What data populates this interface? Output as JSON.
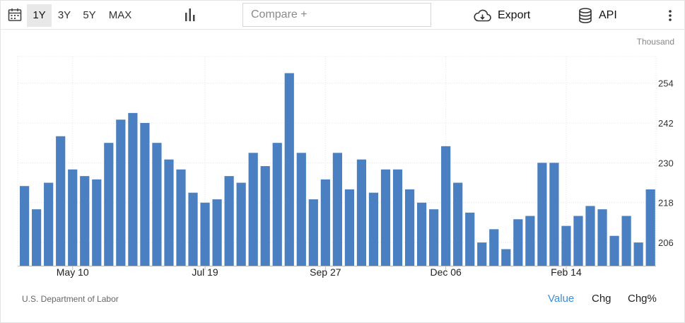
{
  "toolbar": {
    "ranges": [
      {
        "label": "1Y",
        "active": true
      },
      {
        "label": "3Y",
        "active": false
      },
      {
        "label": "5Y",
        "active": false
      },
      {
        "label": "MAX",
        "active": false
      }
    ],
    "compare_placeholder": "Compare +",
    "export_label": "Export",
    "api_label": "API",
    "icons": [
      "calendar-icon",
      "bar-chart-icon",
      "cloud-download-icon",
      "database-icon",
      "more-vertical-icon"
    ]
  },
  "chart_data": {
    "type": "bar",
    "unit": "Thousand",
    "ylim": [
      199,
      262
    ],
    "yticks": [
      206,
      218,
      230,
      242,
      254
    ],
    "x_tick_labels": [
      "May 10",
      "Jul 19",
      "Sep 27",
      "Dec 06",
      "Feb 14"
    ],
    "x_tick_bar_index": [
      4,
      15,
      25,
      35,
      45
    ],
    "grid": true,
    "color": "#4a7fc1",
    "values": [
      223,
      216,
      224,
      238,
      228,
      226,
      225,
      236,
      243,
      245,
      242,
      236,
      231,
      228,
      221,
      218,
      219,
      226,
      224,
      233,
      229,
      236,
      257,
      233,
      219,
      225,
      233,
      222,
      231,
      221,
      228,
      228,
      222,
      218,
      216,
      235,
      224,
      215,
      206,
      210,
      204,
      213,
      214,
      230,
      230,
      211,
      214,
      217,
      216,
      208,
      214,
      206,
      222
    ]
  },
  "footer": {
    "source": "U.S. Department of Labor",
    "views": [
      {
        "label": "Value",
        "active": true
      },
      {
        "label": "Chg",
        "active": false
      },
      {
        "label": "Chg%",
        "active": false
      }
    ]
  }
}
